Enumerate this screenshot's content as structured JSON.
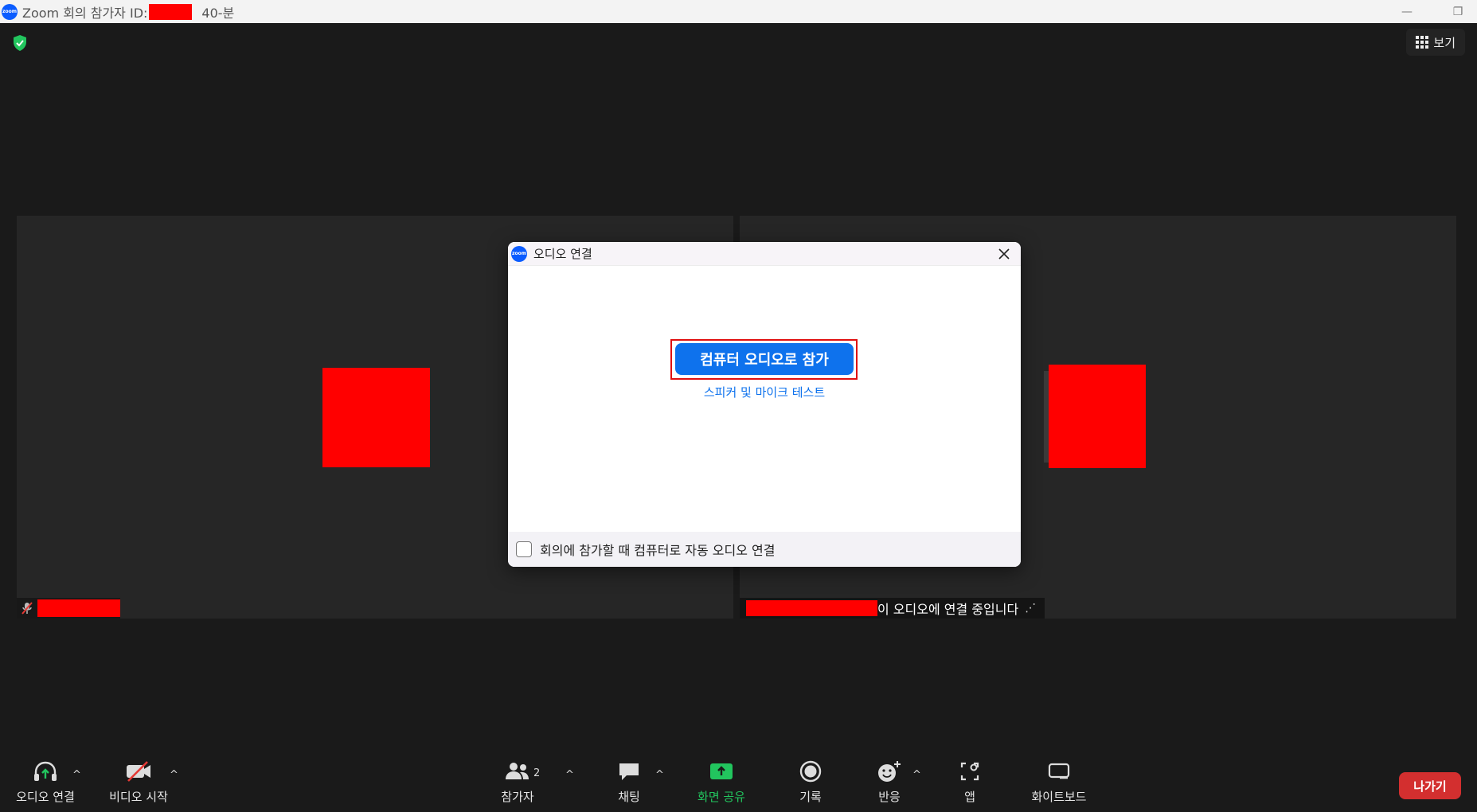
{
  "titlebar": {
    "title": "Zoom 회의 참가자 ID:",
    "timer": "40-분",
    "logo_text": "zoom"
  },
  "top": {
    "view_label": "보기"
  },
  "tiles": {
    "right_status": "이 오디오에 연결 중입니다"
  },
  "dialog": {
    "logo_text": "zoom",
    "title": "오디오 연결",
    "join_button": "컴퓨터 오디오로 참가",
    "test_link": "스피커 및 마이크 테스트",
    "auto_join_checkbox": "회의에 참가할 때 컴퓨터로 자동 오디오 연결"
  },
  "toolbar": {
    "audio": "오디오 연결",
    "video": "비디오 시작",
    "participants": "참가자",
    "participants_count": "2",
    "chat": "채팅",
    "share": "화면 공유",
    "record": "기록",
    "reactions": "반응",
    "apps": "앱",
    "whiteboard": "화이트보드",
    "leave": "나가기",
    "caret": "^"
  },
  "colors": {
    "accent": "#0e72ed",
    "share_green": "#22c55e",
    "leave_red": "#d32f2f",
    "redaction": "#ff0000"
  }
}
